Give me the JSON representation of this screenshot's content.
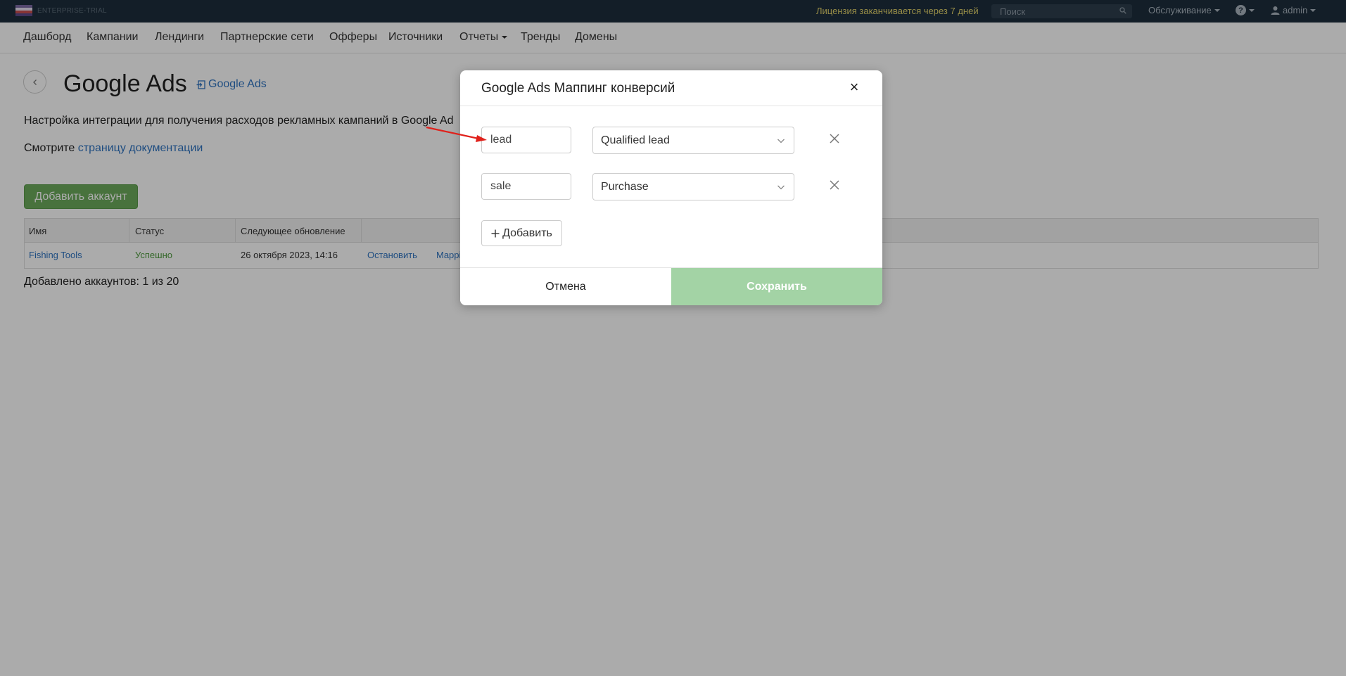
{
  "topbar": {
    "edition": "ENTERPRISE-TRIAL",
    "license_text": "Лицензия заканчивается через 7 дней",
    "search_placeholder": "Поиск",
    "maintenance_label": "Обслуживание",
    "help_label": "?",
    "user_label": "admin"
  },
  "nav": {
    "items": [
      {
        "label": "Дашборд"
      },
      {
        "label": "Кампании"
      },
      {
        "label": "Лендинги"
      },
      {
        "label": "Партнерские сети"
      },
      {
        "label": "Офферы"
      },
      {
        "label": "Источники"
      },
      {
        "label": "Отчеты"
      },
      {
        "label": "Тренды"
      },
      {
        "label": "Домены"
      }
    ]
  },
  "page": {
    "title": "Google Ads",
    "ext_link_label": "Google Ads",
    "description": "Настройка интеграции для получения расходов рекламных кампаний в Google Ad",
    "docs_prefix": "Смотрите ",
    "docs_link": "страницу документации",
    "add_account_label": "Добавить аккаунт",
    "table": {
      "headers": [
        "Имя",
        "Статус",
        "Следующее обновление"
      ],
      "rows": [
        {
          "name": "Fishing Tools",
          "status": "Успешно",
          "next_update": "26 октября 2023, 14:16",
          "action_stop": "Остановить",
          "action_mapping": "Mappi"
        }
      ]
    },
    "counter": "Добавлено аккаунтов: 1 из 20"
  },
  "modal": {
    "title": "Google Ads Маппинг конверсий",
    "close": "×",
    "rows": [
      {
        "key": "lead",
        "value": "Qualified lead"
      },
      {
        "key": "sale",
        "value": "Purchase"
      }
    ],
    "add_label": "Добавить",
    "cancel_label": "Отмена",
    "save_label": "Сохранить"
  },
  "colors": {
    "topbar_bg": "#1d2e3d",
    "license": "#e3d36a",
    "link": "#2f74c0",
    "success": "#4f9c3f",
    "add_account_bg": "#6caa5c",
    "save_bg": "#a3d3a5",
    "annotation_arrow": "#e0211b"
  }
}
